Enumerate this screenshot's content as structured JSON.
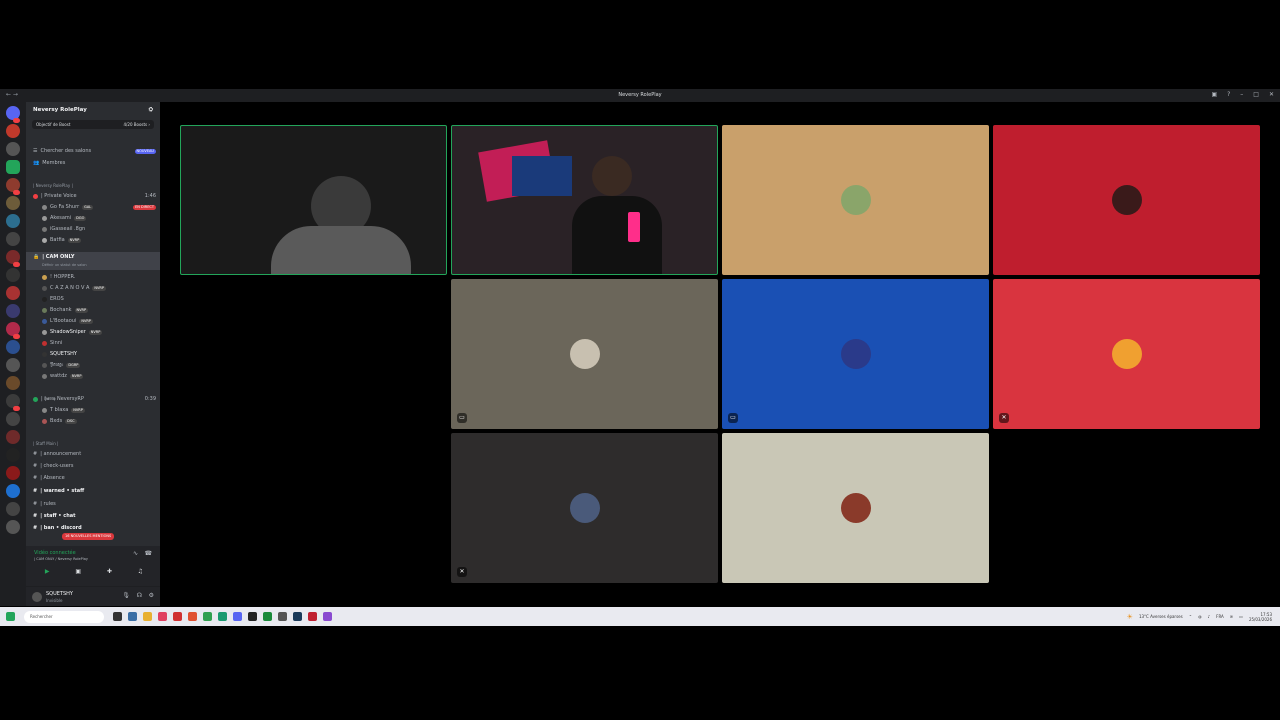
{
  "window": {
    "title": "Neversy RolePlay",
    "nav": "← →"
  },
  "server": {
    "name": "Neversy RolePlay",
    "boost_label": "Objectif de Boost",
    "boost_count": "4/20 Boosts ›",
    "search_channels": "Chercher des salons",
    "new_badge": "NOUVEAU",
    "members": "Membres",
    "category_1": "| Neversy RolePlay |",
    "category_2": "| Staff Main |"
  },
  "voice_channels": [
    {
      "name": "| Private Voice",
      "time": "1:46"
    },
    {
      "name": "| CAM ONLY",
      "status": "Définir un statut de salon"
    },
    {
      "name": "| 𝖍𝖆𝖗𝖗𝖞 NeversyRP",
      "time": "0:39"
    }
  ],
  "private_voice_users": [
    {
      "name": "Go Fa Shurr",
      "tag": "GAL",
      "live": "EN DIRECT"
    },
    {
      "name": "Akesami",
      "tag": "DGO"
    },
    {
      "name": "iGasseail .8gn",
      "tag": ""
    },
    {
      "name": "Batfia",
      "tag": "NVRP"
    }
  ],
  "cam_users": [
    {
      "name": "! HOPPER.",
      "tag": ""
    },
    {
      "name": "C A Z A N O V A",
      "tag": "NVRP"
    },
    {
      "name": "EROS",
      "tag": ""
    },
    {
      "name": "Bochank",
      "tag": "NVRP"
    },
    {
      "name": "L'Bootaoui",
      "tag": "NVRP"
    },
    {
      "name": "ShadowSniper",
      "tag": "NVRP"
    },
    {
      "name": "Sinni",
      "tag": ""
    },
    {
      "name": "SQUETSHY",
      "tag": ""
    },
    {
      "name": "𝔜𝔬𝔯𝔞𝔤𝔢",
      "tag": "DGRP"
    },
    {
      "name": "wattdz",
      "tag": "NVRP"
    }
  ],
  "neversy_voice_users": [
    {
      "name": "T blaxa",
      "tag": "NVRP"
    },
    {
      "name": "Bxds",
      "tag": "DSC"
    }
  ],
  "staff_channels": [
    "| announcement",
    "| check-users",
    "| Absence",
    "| warned • staff",
    "| rules",
    "| staff • chat",
    "| ban • discord"
  ],
  "mentions_badge": "16 NOUVELLES MENTIONS",
  "voice_panel": {
    "status": "Vidéo connectée",
    "channel": "| CAM ONLY / Neversy RolePlay"
  },
  "user_panel": {
    "name": "SQUETSHY",
    "status": "Invisible"
  },
  "taskbar": {
    "search_placeholder": "Rechercher",
    "weather": "13°C Averses éparses",
    "lang": "FRA",
    "time": "17:53",
    "date": "25/03/2026"
  },
  "colors": {
    "tile_tan": "#c9a06b",
    "tile_red": "#bf1e2e",
    "tile_gray": "#6b665a",
    "tile_blue": "#1a50b4",
    "tile_crimson": "#d9343f",
    "tile_dark": "#2e2c2c",
    "tile_beige": "#c9c7b6",
    "speaking_border": "#23a55a"
  }
}
